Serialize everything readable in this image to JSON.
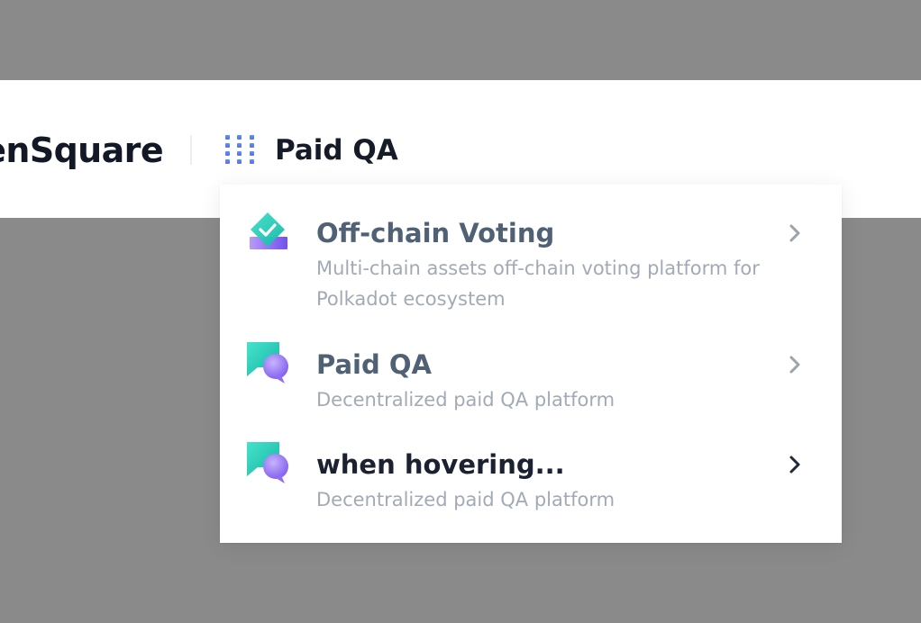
{
  "header": {
    "brand": "enSquare",
    "current_app": "Paid QA"
  },
  "dropdown": {
    "items": [
      {
        "title": "Off-chain Voting",
        "description": "Multi-chain assets off-chain voting platform for Polkadot ecosystem",
        "icon": "voting-icon"
      },
      {
        "title": "Paid QA",
        "description": "Decentralized paid QA platform",
        "icon": "chat-bubbles-icon"
      },
      {
        "title": "when hovering...",
        "description": "Decentralized paid QA platform",
        "icon": "chat-bubbles-icon",
        "state": "hover"
      }
    ]
  },
  "colors": {
    "overlay": "#8a8a8a",
    "brand_text": "#121826",
    "item_title": "#506176",
    "item_title_hover": "#1b2130",
    "item_desc": "#a2aab6",
    "accent_teal": "#2ad8c2",
    "accent_purple": "#8b6cf6"
  }
}
